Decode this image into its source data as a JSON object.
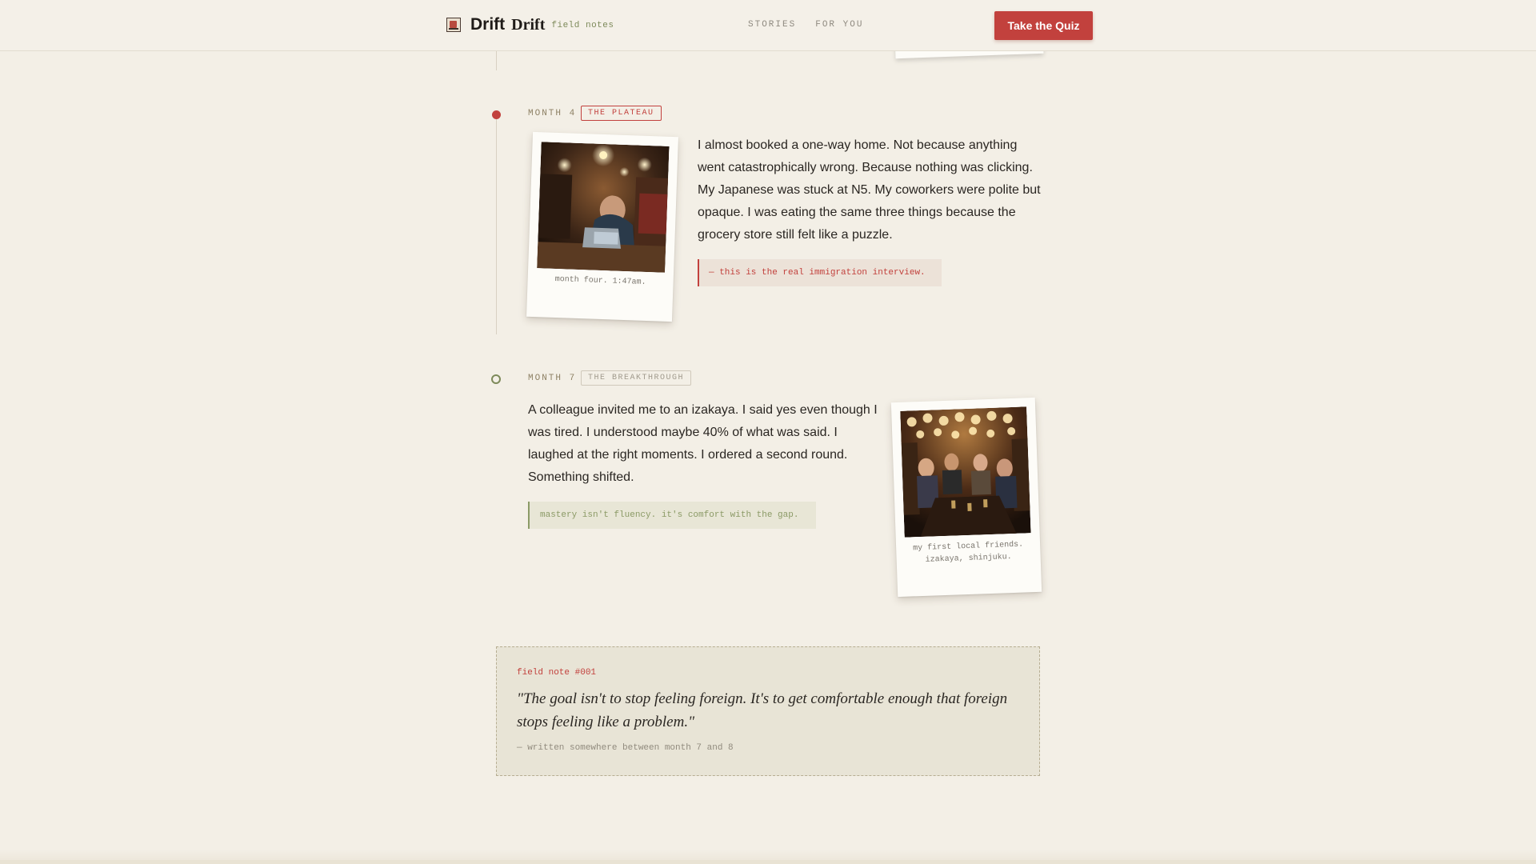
{
  "header": {
    "brand_name": "Drift",
    "brand_name_2": "Drift",
    "brand_sub": "field notes",
    "nav": [
      "STORIES",
      "FOR YOU"
    ],
    "cta": "Take the Quiz"
  },
  "timeline": [
    {
      "month": "MONTH 4",
      "tag": "THE PLATEAU",
      "caption": "month four. 1:47am.",
      "text": "I almost booked a one-way home. Not because anything went catastrophically wrong. Because nothing was clicking. My Japanese was stuck at N5. My coworkers were polite but opaque. I was eating the same three things because the grocery store still felt like a puzzle.",
      "note": "— this is the real immigration interview."
    },
    {
      "month": "MONTH 7",
      "tag": "THE BREAKTHROUGH",
      "caption_line1": "my first local friends.",
      "caption_line2": "izakaya, shinjuku.",
      "text": "A colleague invited me to an izakaya. I said yes even though I was tired. I understood maybe 40% of what was said. I laughed at the right moments. I ordered a second round. Something shifted.",
      "note": "mastery isn't fluency. it's comfort with the gap."
    }
  ],
  "field_note": {
    "label": "field note #001",
    "quote": "\"The goal isn't to stop feeling foreign. It's to get comfortable enough that foreign stops feeling like a problem.\"",
    "signature": "— written somewhere between month 7 and 8"
  },
  "colors": {
    "accent": "#c2413d",
    "green": "#7d8a5a",
    "background": "#f3efe6"
  }
}
